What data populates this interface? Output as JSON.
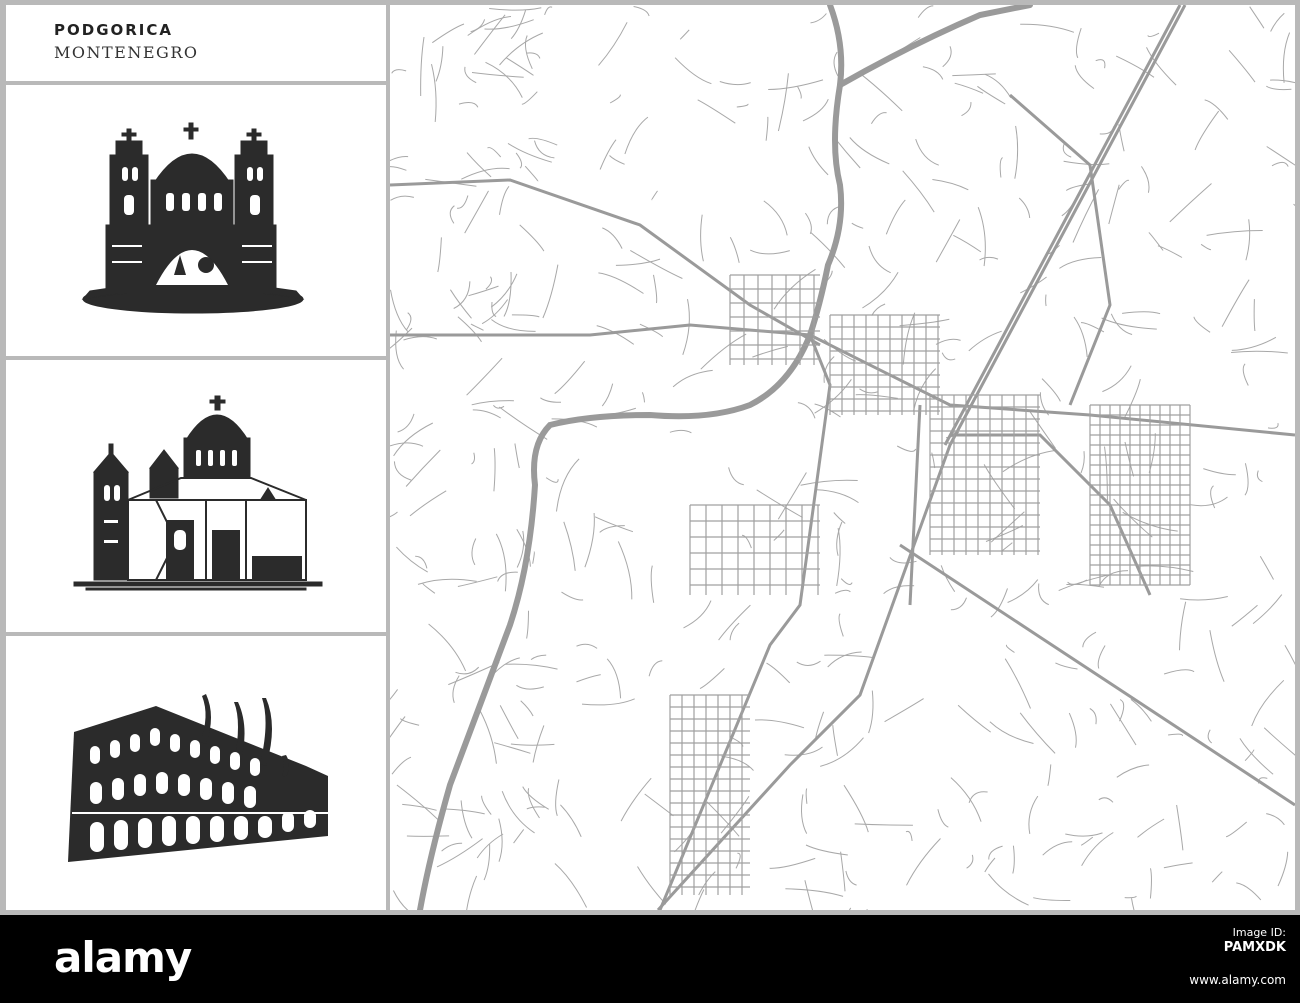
{
  "title": {
    "city": "PODGORICA",
    "country": "MONTENEGRO"
  },
  "landmarks": [
    {
      "icon": "orthodox-cathedral-icon"
    },
    {
      "icon": "domed-church-icon"
    },
    {
      "icon": "arcaded-building-icon"
    }
  ],
  "map": {
    "background": "#ffffff",
    "road_color": "#9a9a9a",
    "river_color": "#9a9a9a"
  },
  "footer": {
    "logo": "alamy",
    "image_id_label": "Image ID:",
    "image_id": "PAMXDK",
    "url": "www.alamy.com"
  },
  "colors": {
    "frame": "#b9b9b9",
    "footer_bg": "#000000",
    "icon_fill": "#2b2b2b"
  }
}
